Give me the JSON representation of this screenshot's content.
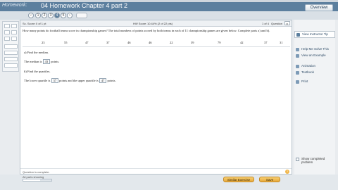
{
  "header": {
    "brand": "Homework:",
    "title": "04 Homework Chapter 4 part 2",
    "overview_label": "Overview"
  },
  "nav": {
    "current": 4,
    "buttons": [
      "‹",
      "1",
      "2",
      "3",
      "4",
      "5",
      "›"
    ]
  },
  "scorebar": {
    "score_label": "Sc. Score:",
    "score_value": "0 of 1 pt",
    "hw_label": "HW Score:",
    "hw_value": "10.44% (2 of 22 pts)",
    "position": "1 of 4",
    "question_ref": "Question"
  },
  "question": {
    "prompt": "How many points do football teams score in championship games? The total numbers of points scored by both teams in each of 11 championship games are given below. Complete parts a) and b).",
    "data": [
      23,
      55,
      47,
      37,
      46,
      46,
      22,
      39,
      79,
      42,
      37,
      31
    ],
    "part_a_label": "a) Find the median.",
    "median_prefix": "The median is",
    "median_value": "43",
    "median_suffix": "points.",
    "part_b_label": "b) Find the quartiles.",
    "quartile_prefix": "The lower quartile is",
    "lower_quartile": "37",
    "quartile_middle": "points and the upper quartile is",
    "upper_quartile": "47",
    "quartile_suffix": "points."
  },
  "card_footer": {
    "status": "Question is complete."
  },
  "sidebar": {
    "top_button": "View Instructor Tip",
    "links": [
      "Help Me Solve This",
      "View an Example",
      "Animation",
      "Textbook",
      "Print"
    ],
    "checkbox_label": "Show completed problem"
  },
  "bottom": {
    "progress_label": "All parts showing",
    "progress_fraction": 0.6,
    "similar_label": "Similar Exercise",
    "save_label": "Save"
  }
}
